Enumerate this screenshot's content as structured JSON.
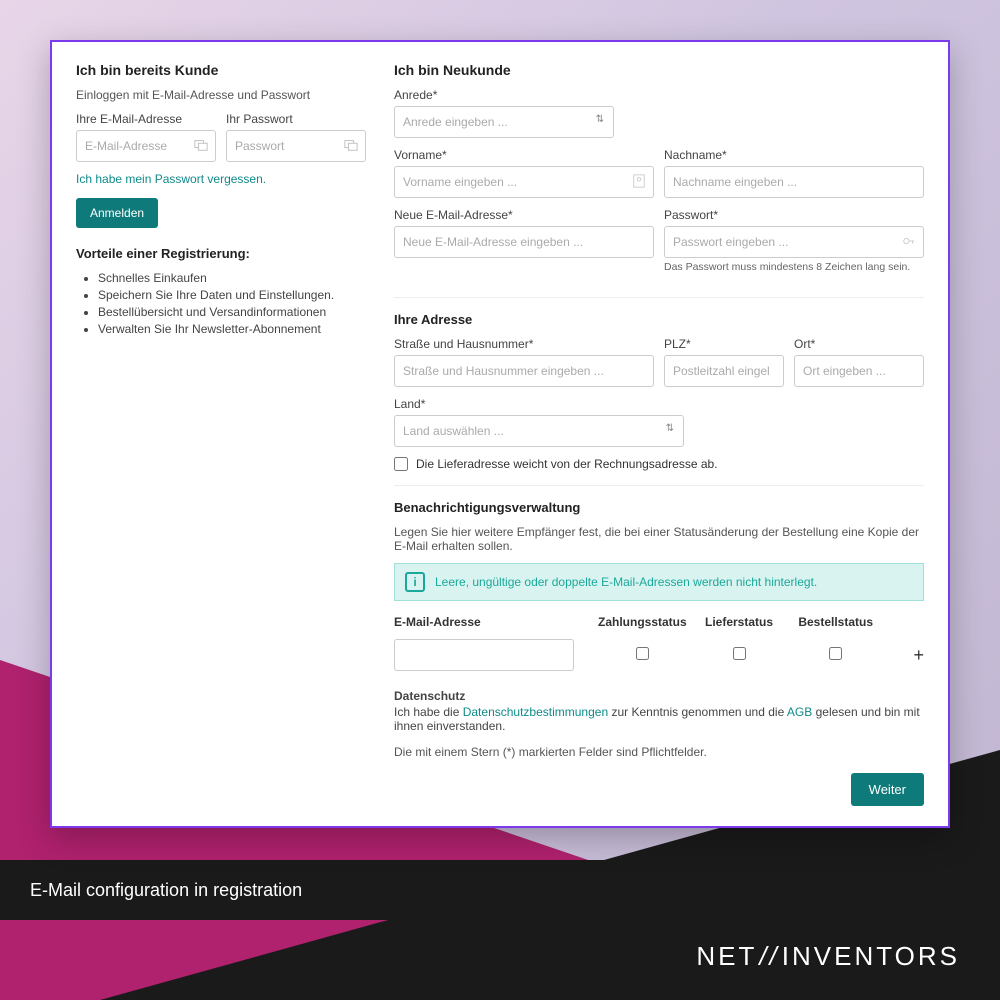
{
  "caption": "E-Mail configuration in registration",
  "brand": {
    "part1": "NET",
    "slashes": "//",
    "part2": "INVENTORS"
  },
  "left": {
    "heading": "Ich bin bereits Kunde",
    "subtext": "Einloggen mit E-Mail-Adresse und Passwort",
    "email_label": "Ihre E-Mail-Adresse",
    "email_placeholder": "E-Mail-Adresse",
    "password_label": "Ihr Passwort",
    "password_placeholder": "Passwort",
    "forgot_link": "Ich habe mein Passwort vergessen.",
    "login_button": "Anmelden",
    "benefits_heading": "Vorteile einer Registrierung:",
    "benefits": [
      "Schnelles Einkaufen",
      "Speichern Sie Ihre Daten und Einstellungen.",
      "Bestellübersicht und Versandinformationen",
      "Verwalten Sie Ihr Newsletter-Abonnement"
    ]
  },
  "right": {
    "heading": "Ich bin Neukunde",
    "salutation_label": "Anrede*",
    "salutation_placeholder": "Anrede eingeben ...",
    "firstname_label": "Vorname*",
    "firstname_placeholder": "Vorname eingeben ...",
    "lastname_label": "Nachname*",
    "lastname_placeholder": "Nachname eingeben ...",
    "new_email_label": "Neue E-Mail-Adresse*",
    "new_email_placeholder": "Neue E-Mail-Adresse eingeben ...",
    "password_label": "Passwort*",
    "password_placeholder": "Passwort eingeben ...",
    "password_hint": "Das Passwort muss mindestens 8 Zeichen lang sein.",
    "address_heading": "Ihre Adresse",
    "street_label": "Straße und Hausnummer*",
    "street_placeholder": "Straße und Hausnummer eingeben ...",
    "zip_label": "PLZ*",
    "zip_placeholder": "Postleitzahl eingel",
    "city_label": "Ort*",
    "city_placeholder": "Ort eingeben ...",
    "country_label": "Land*",
    "country_placeholder": "Land auswählen ...",
    "diff_shipping": "Die Lieferadresse weicht von der Rechnungsadresse ab.",
    "notif_heading": "Benachrichtigungsverwaltung",
    "notif_subtext": "Legen Sie hier weitere Empfänger fest, die bei einer Statusänderung der Bestellung eine Kopie der E-Mail erhalten sollen.",
    "alert_text": "Leere, ungültige oder doppelte E-Mail-Adressen werden nicht hinterlegt.",
    "notif_columns": {
      "c1": "E-Mail-Adresse",
      "c2": "Zahlungsstatus",
      "c3": "Lieferstatus",
      "c4": "Bestellstatus"
    },
    "privacy_heading": "Datenschutz",
    "privacy_text_1": "Ich habe die ",
    "privacy_link_1": "Datenschutzbestimmungen",
    "privacy_text_2": " zur Kenntnis genommen und die ",
    "privacy_link_2": "AGB",
    "privacy_text_3": " gelesen und bin mit ihnen einverstanden.",
    "required_note": "Die mit einem Stern (*) markierten Felder sind Pflichtfelder.",
    "continue_button": "Weiter"
  }
}
